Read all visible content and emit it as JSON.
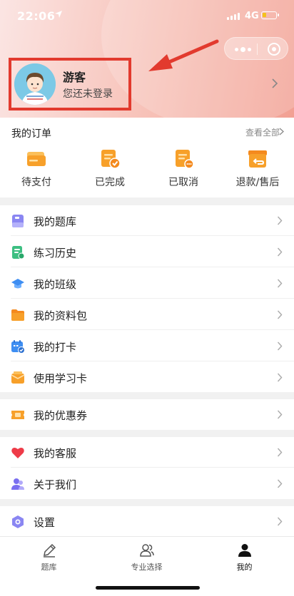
{
  "status_bar": {
    "time": "22:06",
    "network": "4G"
  },
  "profile": {
    "name": "游客",
    "status": "您还未登录"
  },
  "orders": {
    "title": "我的订单",
    "view_all": "查看全部",
    "items": [
      {
        "label": "待支付",
        "icon": "wallet-icon"
      },
      {
        "label": "已完成",
        "icon": "completed-order-icon"
      },
      {
        "label": "已取消",
        "icon": "cancelled-order-icon"
      },
      {
        "label": "退款/售后",
        "icon": "refund-icon"
      }
    ]
  },
  "menu": {
    "question_bank": "我的题库",
    "practice_history": "练习历史",
    "my_class": "我的班级",
    "materials": "我的资料包",
    "checkin": "我的打卡",
    "study_card": "使用学习卡",
    "coupons": "我的优惠券",
    "customer_service": "我的客服",
    "about_us": "关于我们",
    "settings": "设置"
  },
  "tabbar": {
    "tabs": [
      {
        "label": "题库",
        "icon": "pencil-icon"
      },
      {
        "label": "专业选择",
        "icon": "users-icon"
      },
      {
        "label": "我的",
        "icon": "person-icon",
        "active": true
      }
    ]
  },
  "colors": {
    "accent_orange": "#f7a02a",
    "highlight_red": "#e23a2e",
    "header_pink": "#f7c0b6"
  }
}
